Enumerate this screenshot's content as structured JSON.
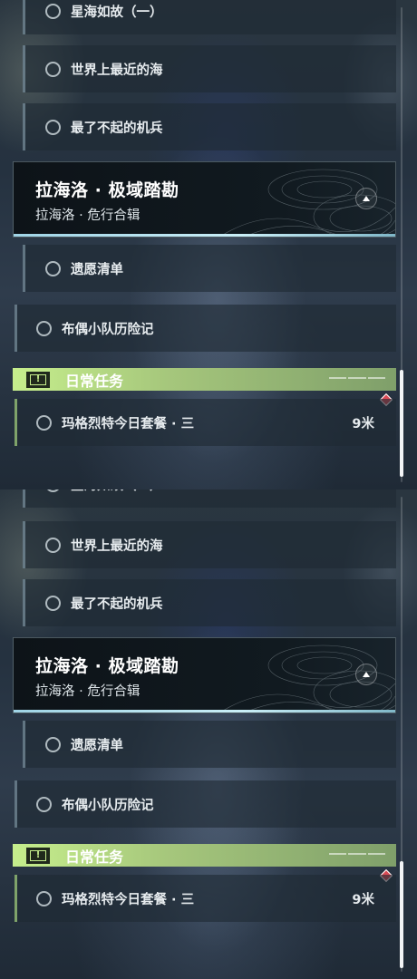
{
  "quest_panel": {
    "sub_quests_top": [
      {
        "label": "星海如故（一）"
      },
      {
        "label": "世界上最近的海"
      },
      {
        "label": "最了不起的机兵"
      }
    ],
    "chapter": {
      "title": "拉海洛 · 极域踏勘",
      "subtitle": "拉海洛 · 危行合辑",
      "toggle_icon": "chevron-up-icon"
    },
    "chapter_items": [
      {
        "label": "遗愿清单"
      }
    ],
    "standalone_items": [
      {
        "label": "布偶小队历险记"
      }
    ],
    "daily": {
      "header": "日常任务",
      "icon": "exclamation-icon",
      "accent": "#c6ee8c",
      "items": [
        {
          "label": "玛格烈特今日套餐 · 三",
          "distance": "9米",
          "marker_color": "#d94b56"
        }
      ]
    }
  },
  "scroll": {
    "position": 0.78
  }
}
